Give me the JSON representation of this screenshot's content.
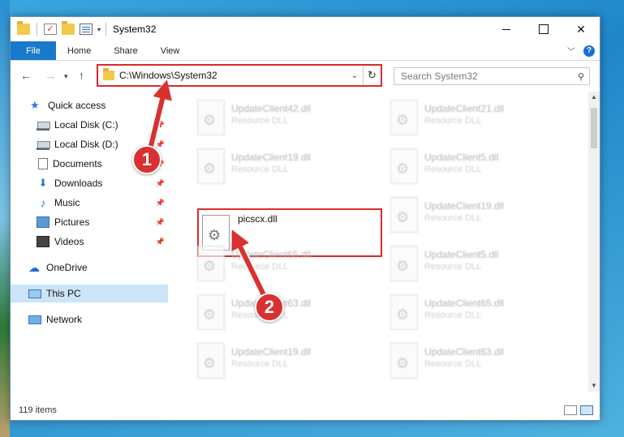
{
  "window": {
    "title": "System32"
  },
  "ribbon": {
    "tabs": [
      "File",
      "Home",
      "Share",
      "View"
    ],
    "help": "?"
  },
  "address": {
    "path": "C:\\Windows\\System32",
    "search_placeholder": "Search System32"
  },
  "nav": {
    "items": [
      {
        "label": "Quick access",
        "icon": "star-icon"
      },
      {
        "label": "Local Disk (C:)",
        "icon": "drive-icon"
      },
      {
        "label": "Local Disk (D:)",
        "icon": "drive-icon"
      },
      {
        "label": "Documents",
        "icon": "document-icon"
      },
      {
        "label": "Downloads",
        "icon": "download-icon"
      },
      {
        "label": "Music",
        "icon": "music-icon"
      },
      {
        "label": "Pictures",
        "icon": "pictures-icon"
      },
      {
        "label": "Videos",
        "icon": "videos-icon"
      },
      {
        "label": "OneDrive",
        "icon": "cloud-icon"
      },
      {
        "label": "This PC",
        "icon": "computer-icon"
      },
      {
        "label": "Network",
        "icon": "network-icon"
      }
    ],
    "selected": "This PC"
  },
  "files": [
    {
      "name": "UpdateClient42.dll",
      "desc": "Resource DLL"
    },
    {
      "name": "UpdateClient21.dll",
      "desc": "Resource DLL"
    },
    {
      "name": "UpdateClient19.dll",
      "desc": "Resource DLL"
    },
    {
      "name": "UpdateClient5.dll",
      "desc": "Resource DLL"
    },
    {
      "name": "picscx.dll",
      "desc": ""
    },
    {
      "name": "UpdateClient19.dll",
      "desc": "Resource DLL"
    },
    {
      "name": "UpdateClient65.dll",
      "desc": "Resource DLL"
    },
    {
      "name": "UpdateClient5.dll",
      "desc": "Resource DLL"
    },
    {
      "name": "UpdateClient63.dll",
      "desc": "Resource DLL"
    },
    {
      "name": "UpdateClient65.dll",
      "desc": "Resource DLL"
    },
    {
      "name": "UpdateClient19.dll",
      "desc": "Resource DLL"
    },
    {
      "name": "UpdateClient63.dll",
      "desc": "Resource DLL"
    }
  ],
  "status": {
    "items_count": "119 items"
  },
  "annotations": {
    "step1": "1",
    "step2": "2",
    "color": "#d93030"
  }
}
